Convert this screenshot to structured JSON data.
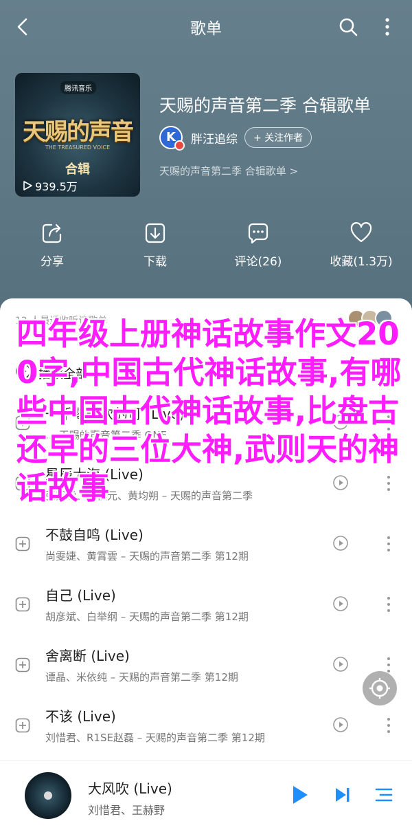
{
  "header": {
    "title": "歌单"
  },
  "album": {
    "cover_brand": "腾讯音乐",
    "cover_title": "天赐的声音",
    "cover_subtitle": "THE TREASURED VOICE",
    "cover_tag": "合辑",
    "play_count": "939.5万",
    "title": "天赐的声音第二季 合辑歌单",
    "author": "胖汪追综",
    "follow_label": "+ 关注作者",
    "description": "天赐的声音第二季 合辑歌单 >"
  },
  "actions": {
    "share": "分享",
    "download": "下载",
    "comment": "评论(26)",
    "favorite": "收藏(1.3万)"
  },
  "list": {
    "recent_text": "12 人最近收听该歌单",
    "play_all": "播放全部",
    "songs": [
      {
        "title": "一千零一次的可 (Live)",
        "subtitle": "… 天赐的声音第二季 ONE"
      },
      {
        "title": "星辰大海 (Live)",
        "subtitle": "张韶涵、郑棋元、黄均朔 – 天赐的声音第二季"
      },
      {
        "title": "不鼓自鸣 (Live)",
        "subtitle": "尚雯婕、黄霄雲 – 天赐的声音第二季 第12期"
      },
      {
        "title": "自己 (Live)",
        "subtitle": "胡彦斌、白举纲 – 天赐的声音第二季 第12期"
      },
      {
        "title": "舍离断 (Live)",
        "subtitle": "谭晶、米依纯 – 天赐的声音第二季 第12期"
      },
      {
        "title": "不该 (Live)",
        "subtitle": "刘惜君、R1SE赵磊 – 天赐的声音第二季 第12期"
      }
    ]
  },
  "overlay": {
    "text": "四年级上册神话故事作文200字,中国古代神话故事,有哪些中国古代神话故事,比盘古还早的三位大神,武则天的神话故事"
  },
  "player": {
    "title": "大风吹 (Live)",
    "artist": "刘惜君、王赫野"
  },
  "colors": {
    "header_bg": "#5f7987",
    "overlay_text": "#ff1dff",
    "accent_blue": "#1f8fff"
  }
}
